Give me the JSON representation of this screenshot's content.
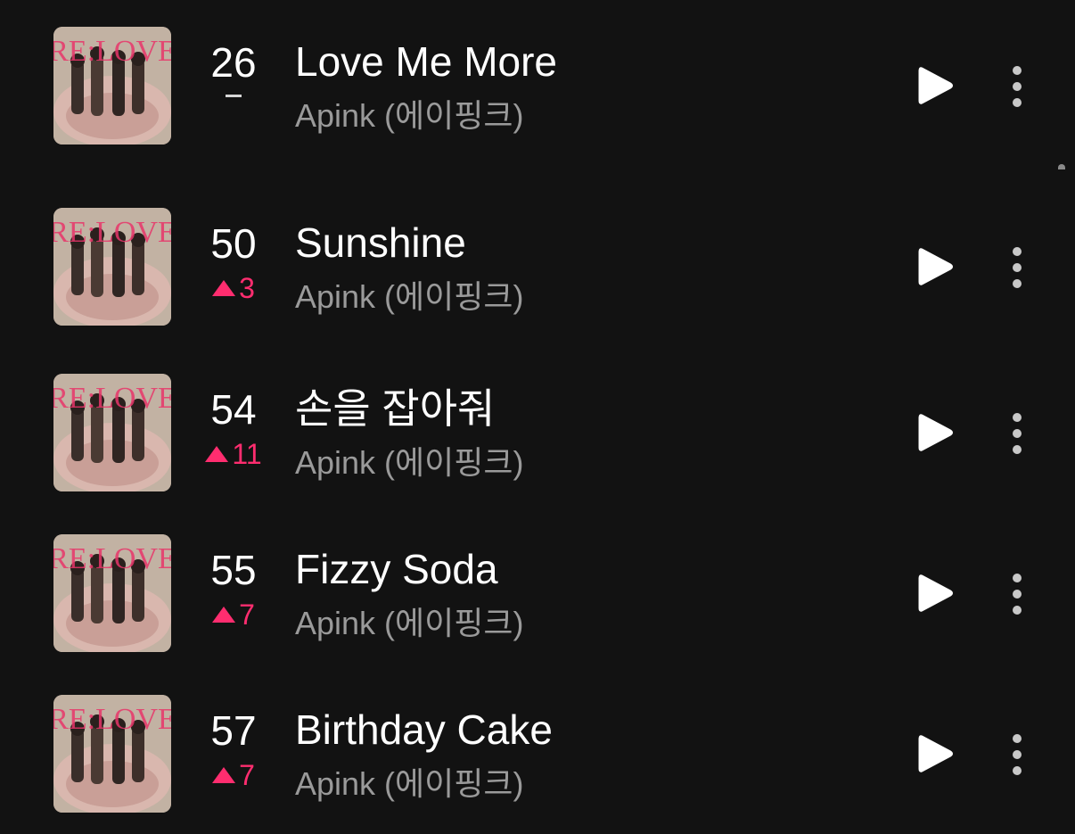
{
  "colors": {
    "background": "#121212",
    "title": "#ffffff",
    "artist": "#9a9a9a",
    "rank_up": "#ff2d6f",
    "icon": "#ffffff"
  },
  "album": {
    "cover_text": "RE:LOVE"
  },
  "tracks": [
    {
      "rank": "26",
      "change_dir": "same",
      "change": "",
      "title": "Love Me More",
      "artist": "Apink (에이핑크)"
    },
    {
      "rank": "50",
      "change_dir": "up",
      "change": "3",
      "title": "Sunshine",
      "artist": "Apink (에이핑크)"
    },
    {
      "rank": "54",
      "change_dir": "up",
      "change": "11",
      "title": "손을 잡아줘",
      "artist": "Apink (에이핑크)"
    },
    {
      "rank": "55",
      "change_dir": "up",
      "change": "7",
      "title": "Fizzy Soda",
      "artist": "Apink (에이핑크)"
    },
    {
      "rank": "57",
      "change_dir": "up",
      "change": "7",
      "title": "Birthday Cake",
      "artist": "Apink (에이핑크)"
    }
  ],
  "icons": {
    "play": "play-icon",
    "more": "more-vertical-icon",
    "rank_up": "triangle-up-icon",
    "rank_same": "dash-icon"
  }
}
